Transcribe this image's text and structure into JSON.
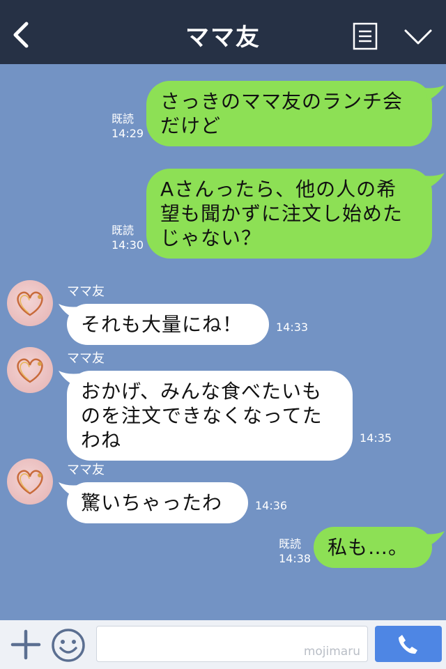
{
  "header": {
    "title": "ママ友",
    "back_icon": "chevron-left-icon",
    "menu_icon": "note-list-icon",
    "collapse_icon": "chevron-down-icon"
  },
  "colors": {
    "header_bg": "#263145",
    "chat_bg": "#7393c4",
    "outgoing_bubble": "#8de055",
    "incoming_bubble": "#ffffff",
    "call_button": "#4e86e4"
  },
  "messages": [
    {
      "direction": "out",
      "lines": [
        "さっきのママ友のランチ会",
        "だけど"
      ],
      "read_label": "既読",
      "time": "14:29"
    },
    {
      "direction": "out",
      "lines": [
        "Aさんったら、他の人の希",
        "望も聞かずに注文し始めた",
        "じゃない？"
      ],
      "read_label": "既読",
      "time": "14:30"
    },
    {
      "direction": "in",
      "sender": "ママ友",
      "lines": [
        "それも大量にね！"
      ],
      "time": "14:33"
    },
    {
      "direction": "in",
      "sender": "ママ友",
      "lines": [
        "おかげ、みんな食べたいも",
        "のを注文できなくなってた",
        "わね"
      ],
      "time": "14:35"
    },
    {
      "direction": "in",
      "sender": "ママ友",
      "lines": [
        "驚いちゃったわ"
      ],
      "time": "14:36"
    },
    {
      "direction": "out",
      "lines": [
        "私も…。"
      ],
      "read_label": "既読",
      "time": "14:38"
    }
  ],
  "footer": {
    "plus_icon": "plus-icon",
    "emoji_icon": "smiley-icon",
    "input_value": "",
    "watermark": "mojimaru",
    "call_icon": "phone-icon"
  }
}
